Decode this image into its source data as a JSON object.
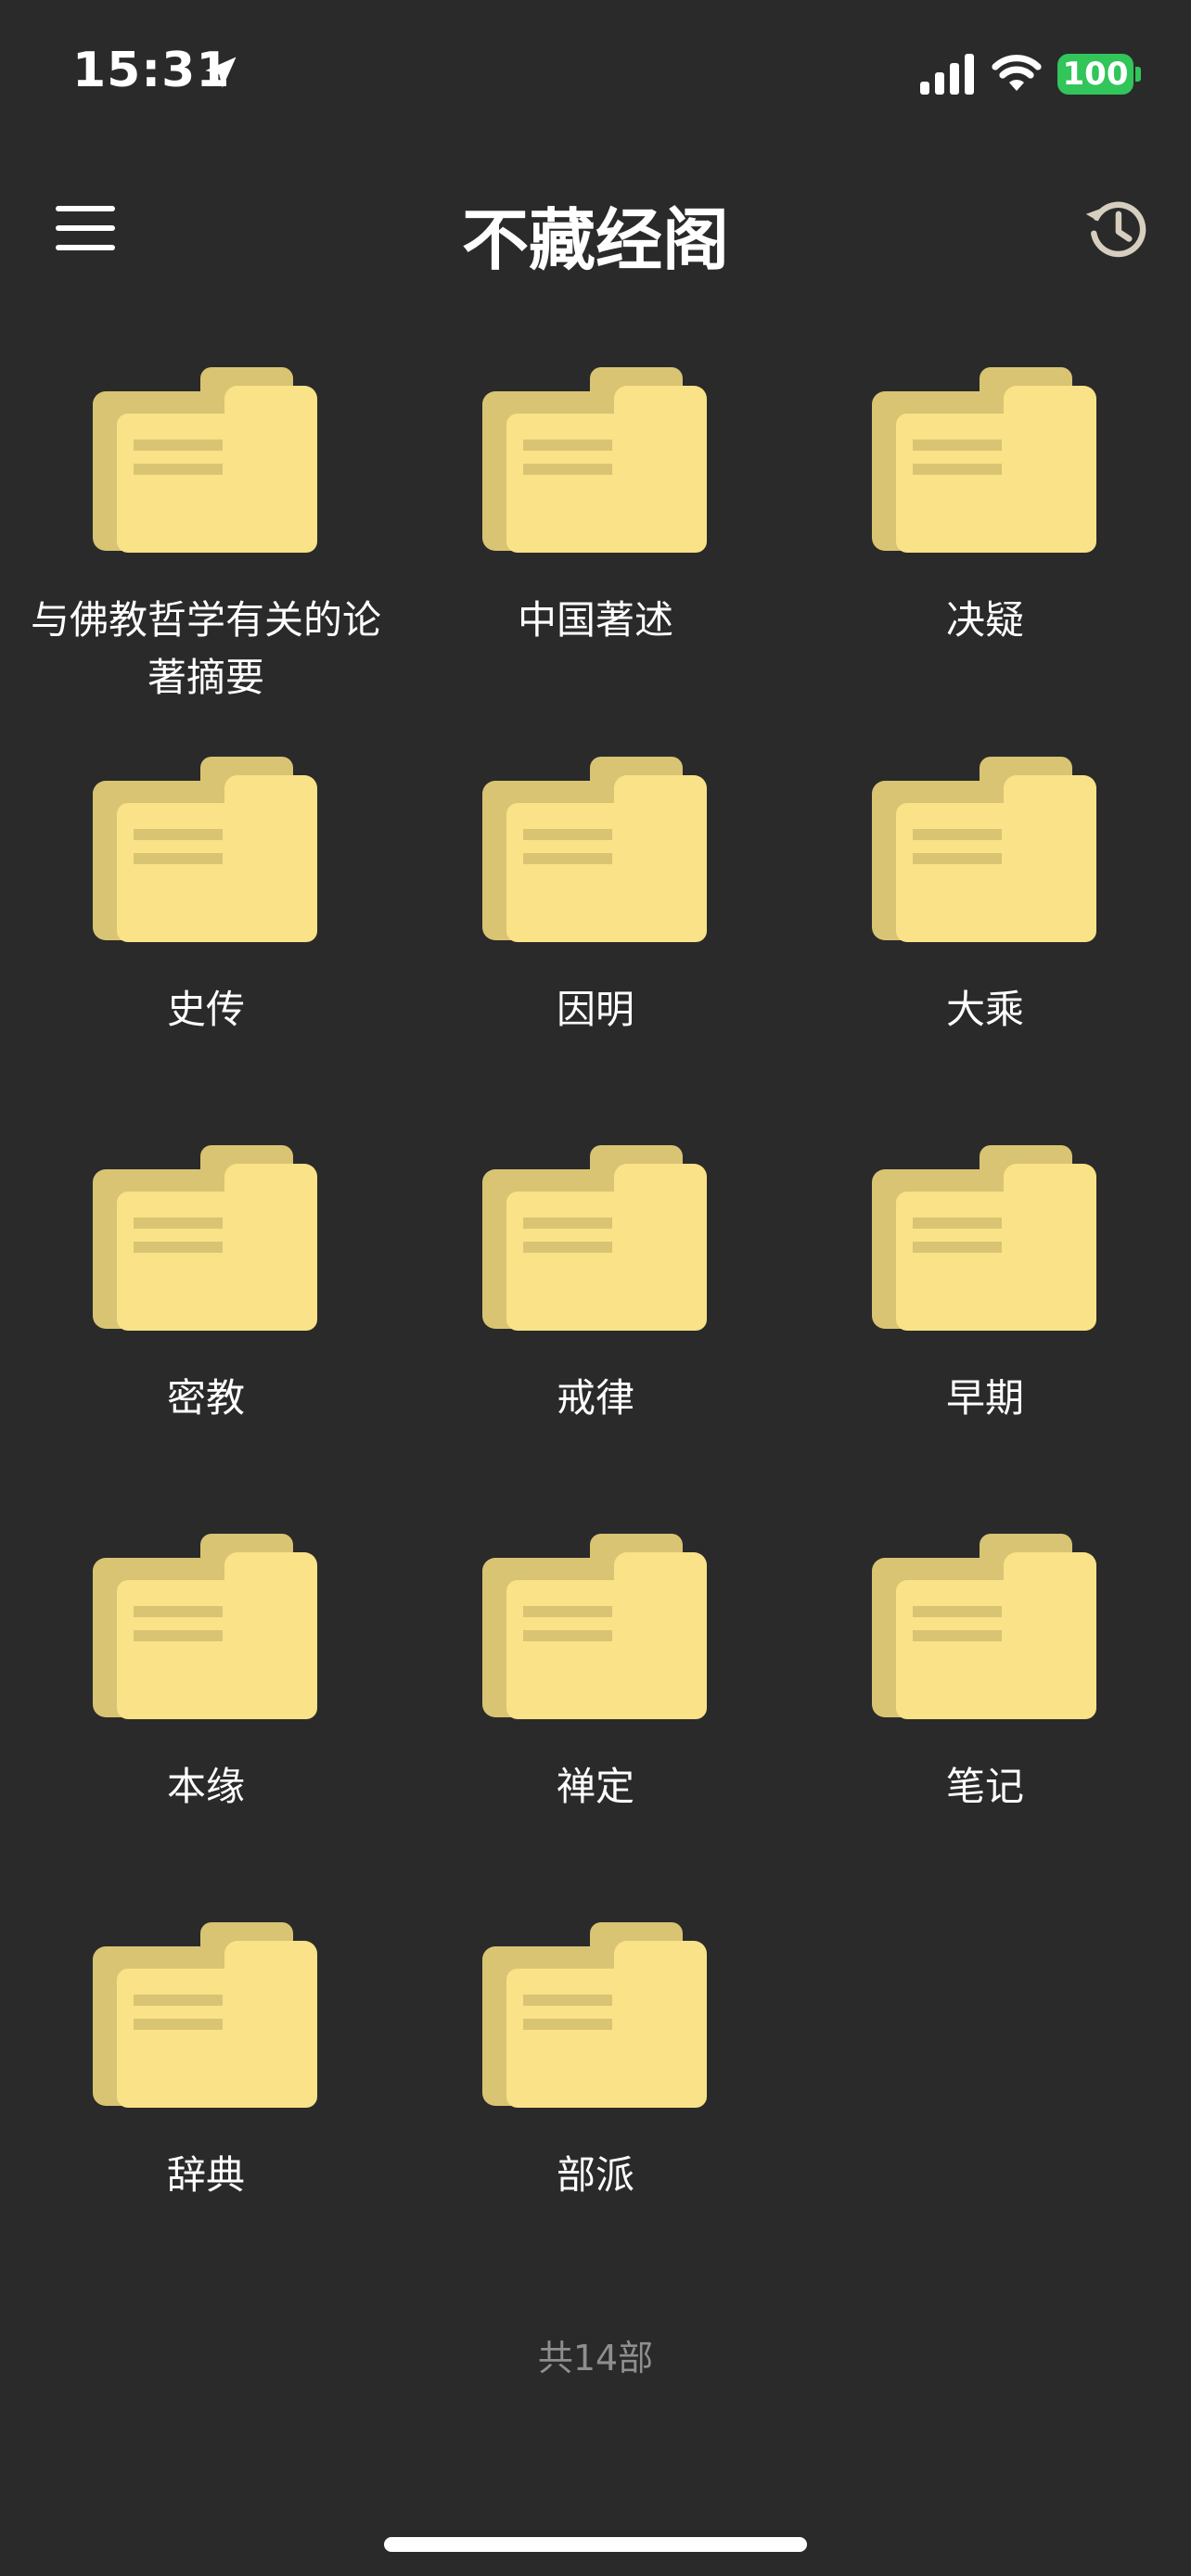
{
  "status_bar": {
    "time": "15:31",
    "battery": "100",
    "location_icon": "location-arrow-icon",
    "signal_icon": "cellular-signal-icon",
    "wifi_icon": "wifi-icon",
    "battery_color": "#31c55a"
  },
  "header": {
    "title": "不藏经阁",
    "menu_icon": "hamburger-menu-icon",
    "history_icon": "history-clock-icon"
  },
  "folders": [
    {
      "label": "与佛教哲学有关的论著摘要"
    },
    {
      "label": "中国著述"
    },
    {
      "label": "决疑"
    },
    {
      "label": "史传"
    },
    {
      "label": "因明"
    },
    {
      "label": "大乘"
    },
    {
      "label": "密教"
    },
    {
      "label": "戒律"
    },
    {
      "label": "早期"
    },
    {
      "label": "本缘"
    },
    {
      "label": "禅定"
    },
    {
      "label": "笔记"
    },
    {
      "label": "辞典"
    },
    {
      "label": "部派"
    }
  ],
  "footer": {
    "count_text": "共14部"
  },
  "colors": {
    "background": "#2a2a2b",
    "folder_front": "#f9e287",
    "folder_back": "#d9c473",
    "folder_lines": "#d9c473"
  }
}
